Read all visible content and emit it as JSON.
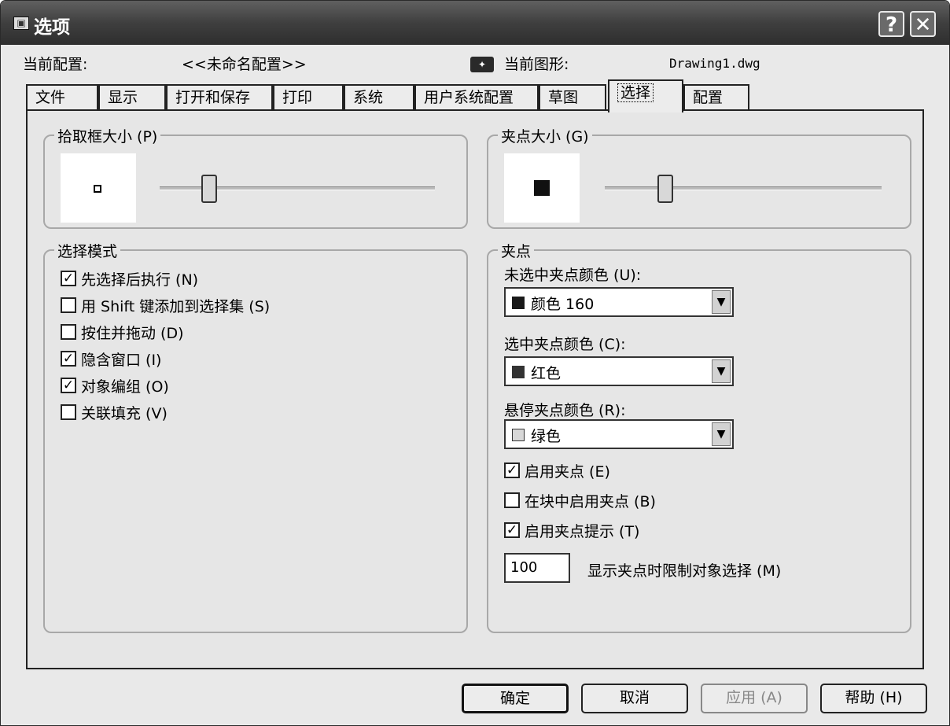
{
  "window": {
    "title": "选项"
  },
  "header": {
    "profile_label": "当前配置:",
    "profile_value": "<<未命名配置>>",
    "drawing_label": "当前图形:",
    "drawing_value": "Drawing1.dwg"
  },
  "tabs": [
    {
      "label": "文件"
    },
    {
      "label": "显示"
    },
    {
      "label": "打开和保存"
    },
    {
      "label": "打印"
    },
    {
      "label": "系统"
    },
    {
      "label": "用户系统配置"
    },
    {
      "label": "草图"
    },
    {
      "label": "选择",
      "active": true
    },
    {
      "label": "配置"
    }
  ],
  "pickbox": {
    "title": "拾取框大小 (P)",
    "slider_level": 0.18
  },
  "gripsize": {
    "title": "夹点大小 (G)",
    "slider_level": 0.22
  },
  "selection_modes": {
    "title": "选择模式",
    "items": [
      {
        "label": "先选择后执行 (N)",
        "checked": true
      },
      {
        "label": "用 Shift 键添加到选择集 (S)",
        "checked": false
      },
      {
        "label": "按住并拖动 (D)",
        "checked": false
      },
      {
        "label": "隐含窗口 (I)",
        "checked": true
      },
      {
        "label": "对象编组 (O)",
        "checked": true
      },
      {
        "label": "关联填充 (V)",
        "checked": false
      }
    ]
  },
  "grips": {
    "title": "夹点",
    "unselected_label": "未选中夹点颜色 (U):",
    "unselected_value": "颜色 160",
    "unselected_color": "#1a1a1a",
    "selected_label": "选中夹点颜色 (C):",
    "selected_value": "红色",
    "selected_color": "#333333",
    "hover_label": "悬停夹点颜色 (R):",
    "hover_value": "绿色",
    "hover_color": "#d8d8d8",
    "checks": [
      {
        "label": "启用夹点 (E)",
        "checked": true
      },
      {
        "label": "在块中启用夹点 (B)",
        "checked": false
      },
      {
        "label": "启用夹点提示 (T)",
        "checked": true
      }
    ],
    "limit_value": "100",
    "limit_label": "显示夹点时限制对象选择 (M)"
  },
  "buttons": {
    "ok": "确定",
    "cancel": "取消",
    "apply": "应用 (A)",
    "help": "帮助 (H)"
  }
}
